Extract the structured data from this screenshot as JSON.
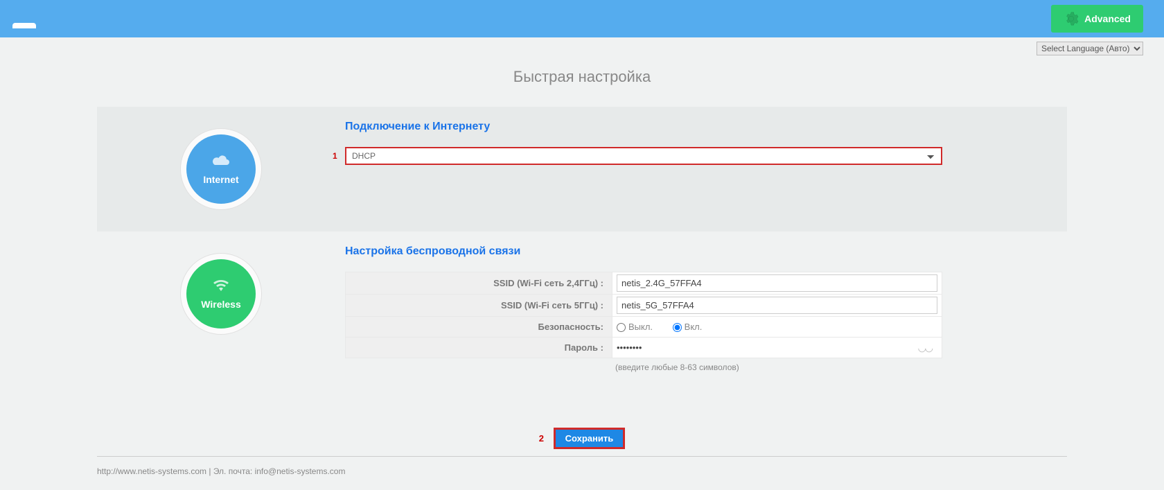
{
  "header": {
    "advanced_label": "Advanced",
    "language_selected": "Select Language (Авто)"
  },
  "page_title": "Быстрая настройка",
  "internet": {
    "circle_label": "Internet",
    "section_title": "Подключение к Интернету",
    "marker": "1",
    "wan_type_selected": "DHCP"
  },
  "wireless": {
    "circle_label": "Wireless",
    "section_title": "Настройка беспроводной связи",
    "rows": {
      "ssid24_label": "SSID (Wi-Fi сеть 2,4ГГц) :",
      "ssid24_value": "netis_2.4G_57FFA4",
      "ssid5_label": "SSID (Wi-Fi сеть 5ГГц) :",
      "ssid5_value": "netis_5G_57FFA4",
      "security_label": "Безопасность:",
      "security_off": "Выкл.",
      "security_on": "Вкл.",
      "password_label": "Пароль :",
      "password_value": "••••••••",
      "password_hint": "(введите любые 8-63 символов)"
    }
  },
  "save": {
    "marker": "2",
    "label": "Сохранить"
  },
  "footer": {
    "text": "http://www.netis-systems.com | Эл. почта: info@netis-systems.com"
  }
}
